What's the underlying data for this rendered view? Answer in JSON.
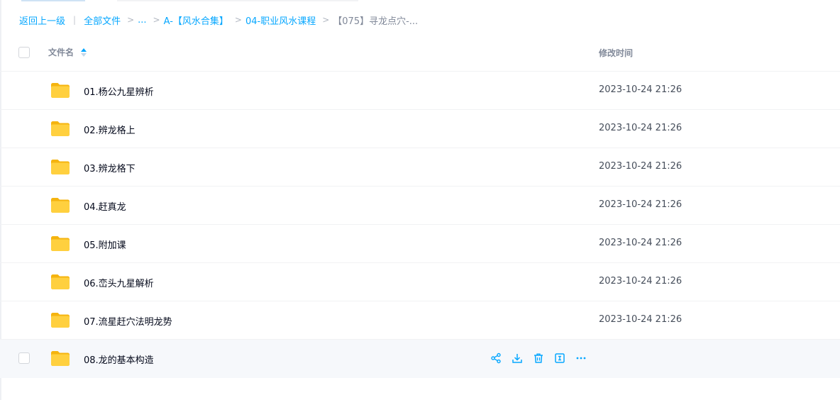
{
  "breadcrumb": {
    "back": "返回上一级",
    "divider": "|",
    "root": "全部文件",
    "ellipsis": "...",
    "level1": "A-【风水合集】",
    "level2": "04-职业风水课程",
    "current": "【075】寻龙点穴-...",
    "separator": ">"
  },
  "table": {
    "col_name": "文件名",
    "col_time": "修改时间"
  },
  "files": [
    {
      "name": "01.杨公九星辨析",
      "time": "2023-10-24 21:26"
    },
    {
      "name": "02.辨龙格上",
      "time": "2023-10-24 21:26"
    },
    {
      "name": "03.辨龙格下",
      "time": "2023-10-24 21:26"
    },
    {
      "name": "04.赶真龙",
      "time": "2023-10-24 21:26"
    },
    {
      "name": "05.附加课",
      "time": "2023-10-24 21:26"
    },
    {
      "name": "06.峦头九星解析",
      "time": "2023-10-24 21:26"
    },
    {
      "name": "07.流星赶穴法明龙势",
      "time": "2023-10-24 21:26"
    },
    {
      "name": "08.龙的基本构造",
      "time": ""
    }
  ],
  "row_actions": [
    "share-icon",
    "download-icon",
    "delete-icon",
    "rename-icon",
    "more-icon"
  ],
  "colors": {
    "accent": "#06a7ff",
    "folder": "#ffc93c",
    "hover_row": "#f6f8fb",
    "muted_text": "#818999"
  }
}
